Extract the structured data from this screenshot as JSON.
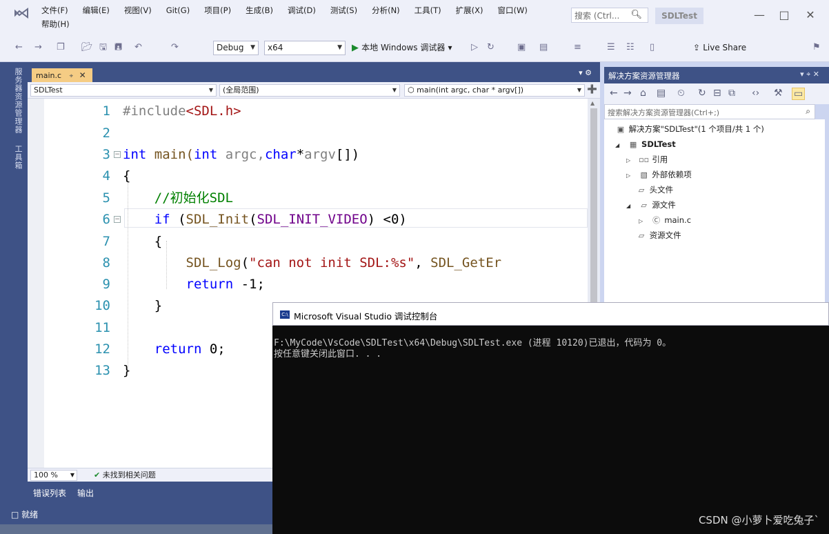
{
  "titlebar": {
    "menus": [
      "文件(F)",
      "编辑(E)",
      "视图(V)",
      "Git(G)",
      "项目(P)",
      "生成(B)",
      "调试(D)",
      "测试(S)",
      "分析(N)",
      "工具(T)",
      "扩展(X)",
      "窗口(W)",
      "帮助(H)"
    ],
    "search_placeholder": "搜索 (Ctrl...",
    "project_name": "SDLTest"
  },
  "toolbar": {
    "config": "Debug",
    "platform": "x64",
    "run_label": "本地 Windows 调试器",
    "live_share": "Live Share"
  },
  "side_strip": {
    "server_explorer": "服务器资源管理器",
    "toolbox": "工具箱"
  },
  "editor": {
    "tab_name": "main.c",
    "nav_project": "SDLTest",
    "nav_scope": "(全局范围)",
    "nav_function": "main(int argc, char * argv[])",
    "line_numbers": [
      "1",
      "2",
      "3",
      "4",
      "5",
      "6",
      "7",
      "8",
      "9",
      "10",
      "11",
      "12",
      "13"
    ],
    "code": {
      "l1a": "#include",
      "l1b": "<SDL.h>",
      "l3a": "int",
      "l3b": " main(",
      "l3c": "int",
      "l3d": " argc,",
      "l3e": "char",
      "l3f": "*",
      "l3g": "argv",
      "l3h": "[])",
      "l4": "{",
      "l5": "    //初始化SDL",
      "l6a": "    ",
      "l6b": "if",
      "l6c": " (",
      "l6d": "SDL_Init",
      "l6e": "(",
      "l6f": "SDL_INIT_VIDEO",
      "l6g": ") <0)",
      "l7": "    {",
      "l8a": "        ",
      "l8b": "SDL_Log",
      "l8c": "(",
      "l8d": "\"can not init SDL:%s\"",
      "l8e": ", ",
      "l8f": "SDL_GetEr",
      "l9a": "        ",
      "l9b": "return",
      "l9c": " -1;",
      "l10": "    }",
      "l12a": "    ",
      "l12b": "return",
      "l12c": " 0;",
      "l13": "}"
    },
    "zoom": "100 %",
    "issues": "未找到相关问题"
  },
  "bottom_tabs": [
    "错误列表",
    "输出"
  ],
  "status": "就绪",
  "solution_explorer": {
    "title": "解决方案资源管理器",
    "search_placeholder": "搜索解决方案资源管理器(Ctrl+;)",
    "tree": {
      "solution": "解决方案\"SDLTest\"(1 个项目/共 1 个)",
      "project": "SDLTest",
      "references": "引用",
      "external_deps": "外部依赖项",
      "header_files": "头文件",
      "source_files": "源文件",
      "main_c": "main.c",
      "resource_files": "资源文件"
    }
  },
  "console": {
    "title": "Microsoft Visual Studio 调试控制台",
    "lines": [
      "F:\\MyCode\\VsCode\\SDLTest\\x64\\Debug\\SDLTest.exe (进程 10120)已退出，代码为 0。",
      "按任意键关闭此窗口. . ."
    ]
  },
  "watermark": "CSDN @小萝卜爱吃兔子`"
}
